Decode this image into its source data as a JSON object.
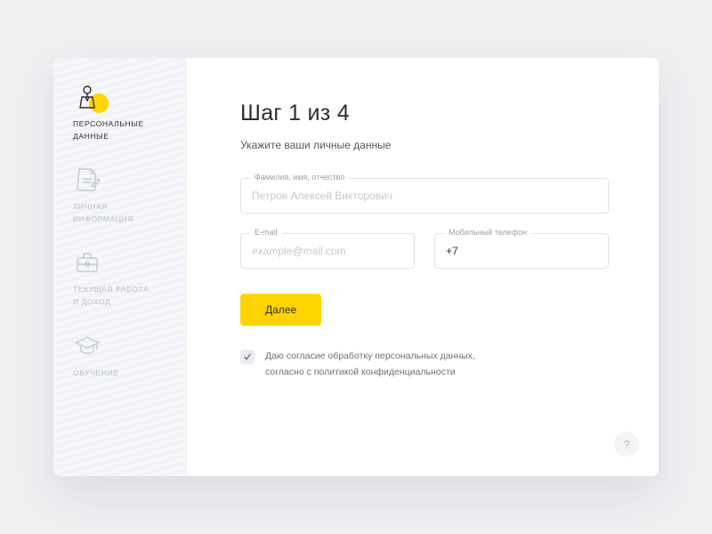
{
  "colors": {
    "accent": "#ffd400"
  },
  "step": {
    "title": "Шаг 1 из 4",
    "subtitle": "Укажите ваши личные данные"
  },
  "sidebar": [
    {
      "icon": "person-icon",
      "label": "ПЕРСОНАЛЬНЫЕ\nДАННЫЕ",
      "active": true
    },
    {
      "icon": "document-icon",
      "label": "ЛИЧНАЯ\nИНФОРМАЦИЯ",
      "active": false
    },
    {
      "icon": "briefcase-icon",
      "label": "ТЕКУЩАЯ РАБОТА\nИ ДОХОД",
      "active": false
    },
    {
      "icon": "graduation-icon",
      "label": "ОБУЧЕНИЕ",
      "active": false
    }
  ],
  "fields": {
    "fullname": {
      "label": "Фамилия, имя, отчество",
      "placeholder": "Петров Алексей Викторович",
      "value": ""
    },
    "email": {
      "label": "E-mail",
      "placeholder": "example@mail.com",
      "value": ""
    },
    "phone": {
      "label": "Мобильный телефон",
      "placeholder": "",
      "value": "+7"
    }
  },
  "buttons": {
    "next": "Далее"
  },
  "consent": {
    "checked": true,
    "text": "Даю согласие обработку персональных данных, согласно с политикой конфиденциальности"
  },
  "help": {
    "label": "?"
  }
}
